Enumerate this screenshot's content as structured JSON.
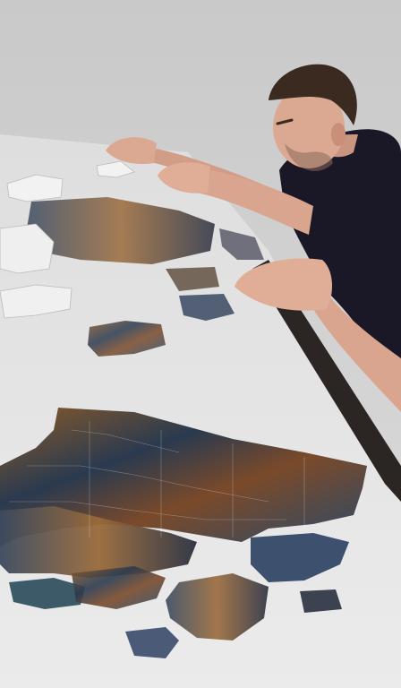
{
  "scene": {
    "subject": "person-assembling-jigsaw-puzzle",
    "colors": {
      "wall": "#cfcfcf",
      "table": "#e6e6e6",
      "table_edge": "#2b2623",
      "shirt": "#1a1826",
      "skin": "#d9a58f",
      "hair": "#3a2a20",
      "puzzle_dark": "#2a3a4f",
      "puzzle_warm": "#8a5a2a",
      "puzzle_white": "#f2f2f2"
    }
  }
}
